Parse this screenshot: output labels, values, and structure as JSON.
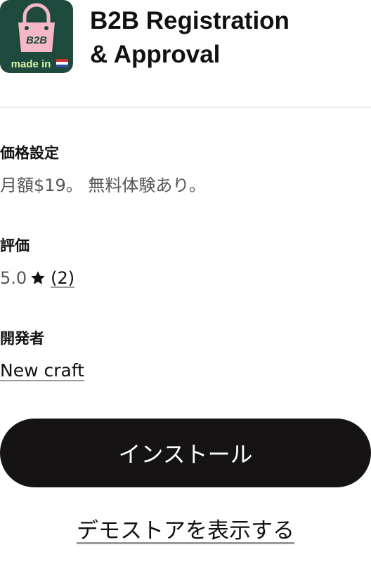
{
  "app": {
    "title_line1": "B2B Registration",
    "title_line2": "& Approval",
    "icon": {
      "name": "shopping-bag-icon",
      "bag_text": "B2B",
      "badge_text": "made in",
      "flag": "netherlands-flag-icon",
      "bg_color": "#1d4a3c",
      "bag_color": "#f6b7c7",
      "badge_color": "#d8f2a6"
    }
  },
  "pricing": {
    "label": "価格設定",
    "value": "月額$19。 無料体験あり。"
  },
  "rating": {
    "label": "評価",
    "score": "5.0",
    "icon": "star-icon",
    "reviews": "(2)"
  },
  "developer": {
    "label": "開発者",
    "name": "New craft"
  },
  "actions": {
    "install_label": "インストール",
    "demo_label": "デモストアを表示する"
  },
  "colors": {
    "button_bg": "#161314",
    "text": "#111111",
    "muted": "#555555",
    "divider": "#e6e6e6"
  }
}
